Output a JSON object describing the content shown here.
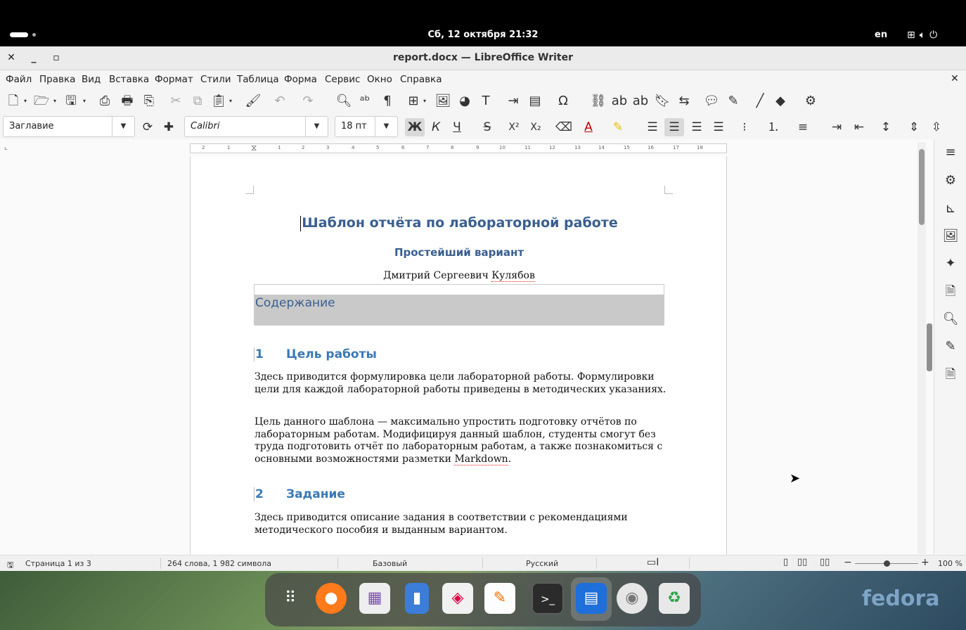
{
  "topbar": {
    "clock": "Сб, 12 октября  21:32",
    "lang": "en",
    "tray_icons": [
      "network-icon",
      "volume-icon",
      "power-icon"
    ]
  },
  "window": {
    "title": "report.docx — LibreOffice Writer",
    "close": "✕",
    "minimize": "_",
    "maximize": "▫"
  },
  "menu": {
    "items": [
      "Файл",
      "Правка",
      "Вид",
      "Вставка",
      "Формат",
      "Стили",
      "Таблица",
      "Форма",
      "Сервис",
      "Окно",
      "Справка"
    ],
    "close": "✕"
  },
  "formatting": {
    "paragraph_style": "Заглавие",
    "font_name": "Calibri",
    "font_size": "18 пт",
    "bold_label": "Ж",
    "italic_label": "К",
    "underline_label": "Ч",
    "strike_label": "S"
  },
  "ruler": {
    "labels": [
      "2",
      "1",
      "1",
      "2",
      "3",
      "4",
      "5",
      "6",
      "7",
      "8",
      "9",
      "10",
      "11",
      "12",
      "13",
      "14",
      "15",
      "16",
      "17",
      "18"
    ]
  },
  "document": {
    "title": "Шаблон отчёта по лабораторной работе",
    "subtitle": "Простейший вариант",
    "author_first": "Дмитрий Сергеевич ",
    "author_last": "Кулябов",
    "toc_title": "Содержание",
    "section1_num": "1",
    "section1_title": "Цель работы",
    "para1": "Здесь приводится формулировка цели лабораторной работы. Формулировки цели для каждой лабораторной работы приведены в методических указаниях.",
    "para2_main": "Цель данного шаблона — максимально упростить подготовку отчётов по лабораторным работам. Модифицируя данный шаблон, студенты смогут без труда подготовить отчёт по лабораторным работам, а также познакомиться с основными возможностями разметки ",
    "para2_word": "Markdown",
    "para2_end": ".",
    "section2_num": "2",
    "section2_title": "Задание",
    "para3": "Здесь приводится описание задания в соответствии с рекомендациями методического пособия и выданным вариантом."
  },
  "status": {
    "page": "Страница 1 из 3",
    "words": "264 слова, 1 982 символа",
    "page_style": "Базовый",
    "language": "Русский",
    "zoom": "100 %",
    "zoom_fraction": 0.5
  },
  "dock": {
    "apps": [
      "app-grid-icon",
      "firefox-icon",
      "calendar-icon",
      "files-icon",
      "software-icon",
      "text-editor-icon",
      "terminal-icon",
      "writer-icon",
      "disc-icon",
      "trash-icon"
    ],
    "brand": "fedora"
  }
}
